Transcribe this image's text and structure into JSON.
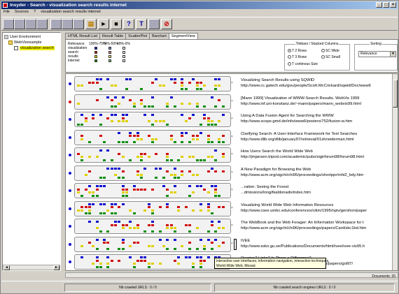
{
  "window": {
    "title": "Insyder - Search - visualization search results internet"
  },
  "menu": {
    "items": [
      "File",
      "Sources",
      "?",
      "visualization search results internet"
    ]
  },
  "toolbar": {
    "buttons": [
      {
        "icon": "grid-icon"
      },
      {
        "icon": "grid-icon"
      },
      {
        "icon": "grid-icon"
      },
      {
        "icon": "grid-icon"
      },
      {
        "icon": "grid-icon"
      },
      {
        "icon": "grid-icon"
      },
      {
        "icon": "grid-icon"
      },
      {
        "icon": "document-icon"
      },
      {
        "icon": "play-icon"
      },
      {
        "icon": "stop-icon"
      },
      {
        "icon": "help-icon"
      },
      {
        "icon": "tools-icon"
      },
      {
        "icon": "grid-icon"
      },
      {
        "icon": "no-entry-icon"
      }
    ]
  },
  "sidebar": {
    "root": "User Environment",
    "child": "WebVizexample",
    "leaf": "visualization search"
  },
  "tabs": [
    "HTML Result List",
    "Result Table",
    "ScatterPlot",
    "Barchart",
    "SegmentView"
  ],
  "active_tab": 4,
  "legend": {
    "headers": [
      "Relevance",
      "100%-75%",
      "74%-50%",
      "49%-0%"
    ],
    "rows": [
      {
        "name": "visualization",
        "colors": [
          "#1010d0",
          "#8080e0",
          "#ffffff"
        ]
      },
      {
        "name": "search",
        "colors": [
          "#d01010",
          "#e08080",
          "#ffffff"
        ]
      },
      {
        "name": "results",
        "colors": [
          "#e0e000",
          "#f0f080",
          "#ffffff"
        ]
      },
      {
        "name": "internet",
        "colors": [
          "#109010",
          "#80c080",
          "#ffffff"
        ]
      }
    ]
  },
  "tiles_group": {
    "title": "Tilebars / Stacked Columns",
    "options": [
      "T 2 Rows",
      "SC Wide",
      "T 3 Rows",
      "SC Small",
      "T continous Size"
    ],
    "selected": "T 2 Rows"
  },
  "sorting": {
    "title": "Sorting",
    "value": "Relevance"
  },
  "results": [
    {
      "title": "Visualizing Search Results using SQWID",
      "url": "http://www.cc.gatech.edu/gvu/people/Scott.McCrickard/sqwid/Doc/www6",
      "bullet": "#1010d0"
    },
    {
      "title": "[Mann 1999] Visualization of WWW-Search Results. WebVis 1999",
      "url": "http://www.inf.uni-konstanz.de/~mann/papers/mann_webvis99.html",
      "bullet": "#d01010"
    },
    {
      "title": "Using A Data Fusion Agent for Searching the WWW",
      "url": "http://www.scope.gmd.de/info/www6/posters/752/fusion-w.htm",
      "bullet": "#1010d0"
    },
    {
      "title": "Clarifying Search: A User-Interface Framework for Text Searches",
      "url": "http://www.dlib.org/dlib/january97/retrieval/01shneiderman.html",
      "bullet": "#1010d0"
    },
    {
      "title": "How Users Search the World Wide Web",
      "url": "http://jmjansen.tripod.com/academic/pubs/sigirforum98/forum98.html",
      "bullet": "#1010d0"
    },
    {
      "title": "A New Paradigm for Browsing the Web",
      "url": "http://www.acm.org/sigchi/chi95/proceedings/shortppr/mht2_bdy.htm",
      "bullet": "#1010d0"
    },
    {
      "title": "...ration: Seeing the Forest",
      "url": "...dmissions/long/tkaldonado/index.htm",
      "bullet": "#1010d0"
    },
    {
      "title": "Visualizing World Wide Web Information Resources",
      "url": "http://www.csee.umbc.edu/conferences/cikm/1995/npiv/gershon/paper",
      "bullet": "#1010d0"
    },
    {
      "title": "The WebBook and the Web Forager: An Information Workspace for t",
      "url": "http://www.acm.org/sigchi/chi96/proceedings/papers/Card/skc1bd.htm",
      "bullet": "#1010d0"
    },
    {
      "title": "IVEE",
      "url": "http://www.ssko.gu.se/Publications/Documents/html/ivee/ivee-vis95.h",
      "bullet": "#1010d0"
    },
    {
      "title": "Queries? Links? Is There a Difference?",
      "url": "http://www.fxpal.xerox.com/PapersAndAbstracts/papers/gol97/",
      "bullet": "#1010d0"
    }
  ],
  "tooltip": {
    "line1": "interactive user interfaces, information navigation, interaction techniques,",
    "line2": "World-Wide Web, Mosaic"
  },
  "documents_label": "Documents: 20",
  "status": {
    "left": "Nb crawled URLS : 0 / 0",
    "right": "Nb crawled search engines URLS : 0 / 0"
  }
}
